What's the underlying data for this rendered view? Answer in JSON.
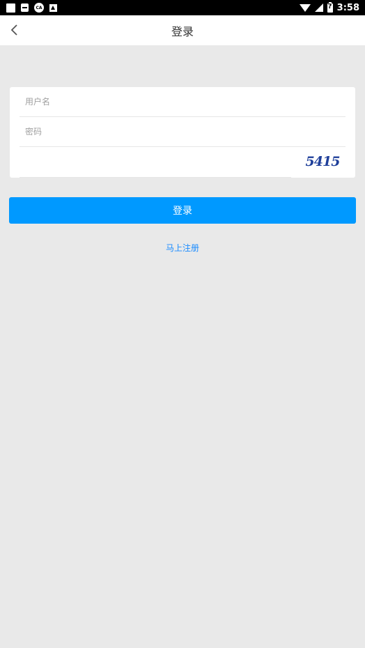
{
  "status_bar": {
    "time": "3:58",
    "left_icons": [
      "notification-square-icon",
      "sim-card-icon",
      "cloud-app-icon",
      "warning-icon"
    ],
    "right_icons": [
      "wifi-icon",
      "cellular-signal-icon",
      "battery-icon"
    ]
  },
  "nav": {
    "title": "登录",
    "back_icon": "chevron-left-icon"
  },
  "form": {
    "username": {
      "placeholder": "用户名",
      "value": ""
    },
    "password": {
      "placeholder": "密码",
      "value": ""
    },
    "captcha": {
      "placeholder": "",
      "value": "",
      "image_text": "5415",
      "image_color": "#1f3f9a"
    }
  },
  "actions": {
    "login_label": "登录",
    "login_color": "#0099ff",
    "register_label": "马上注册",
    "register_color": "#1a8cff"
  }
}
